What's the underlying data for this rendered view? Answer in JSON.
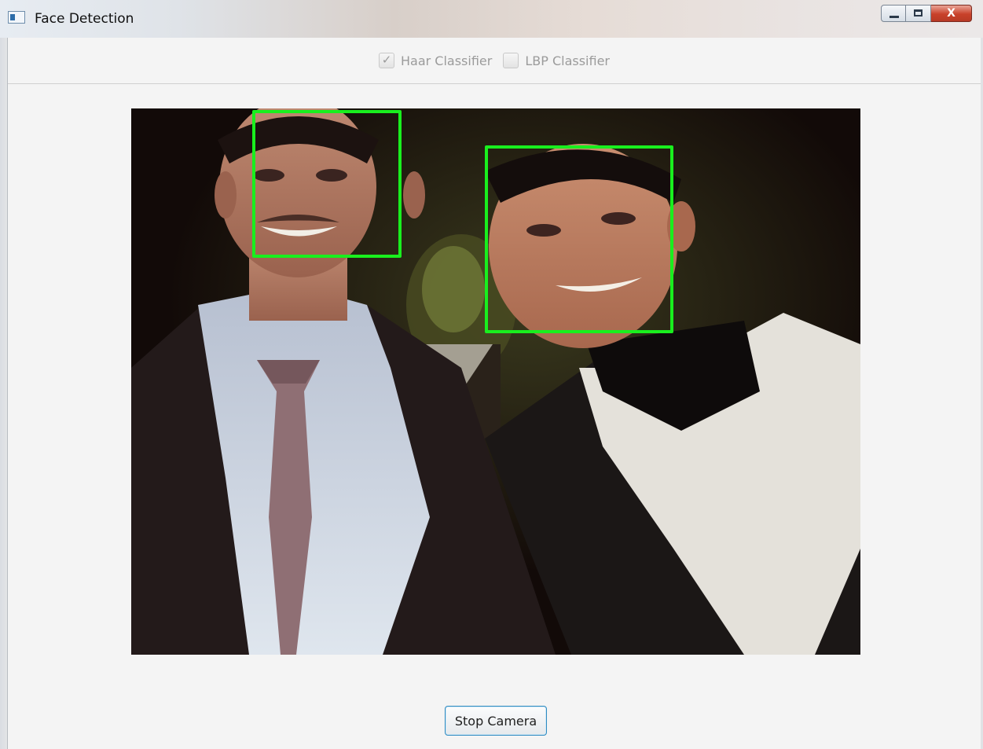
{
  "window": {
    "title": "Face Detection",
    "caption_buttons": {
      "minimize_icon": "minimize-icon",
      "maximize_icon": "maximize-icon",
      "close_glyph": "X"
    }
  },
  "classifiers": {
    "haar": {
      "label": "Haar Classifier",
      "checked": true,
      "disabled": true
    },
    "lbp": {
      "label": "LBP Classifier",
      "checked": false,
      "disabled": true
    }
  },
  "camera": {
    "description": "live camera frame",
    "detections": [
      {
        "name": "face-1",
        "color": "#19ef1e"
      },
      {
        "name": "face-2",
        "color": "#19ef1e"
      }
    ]
  },
  "actions": {
    "stop_camera_label": "Stop Camera"
  }
}
